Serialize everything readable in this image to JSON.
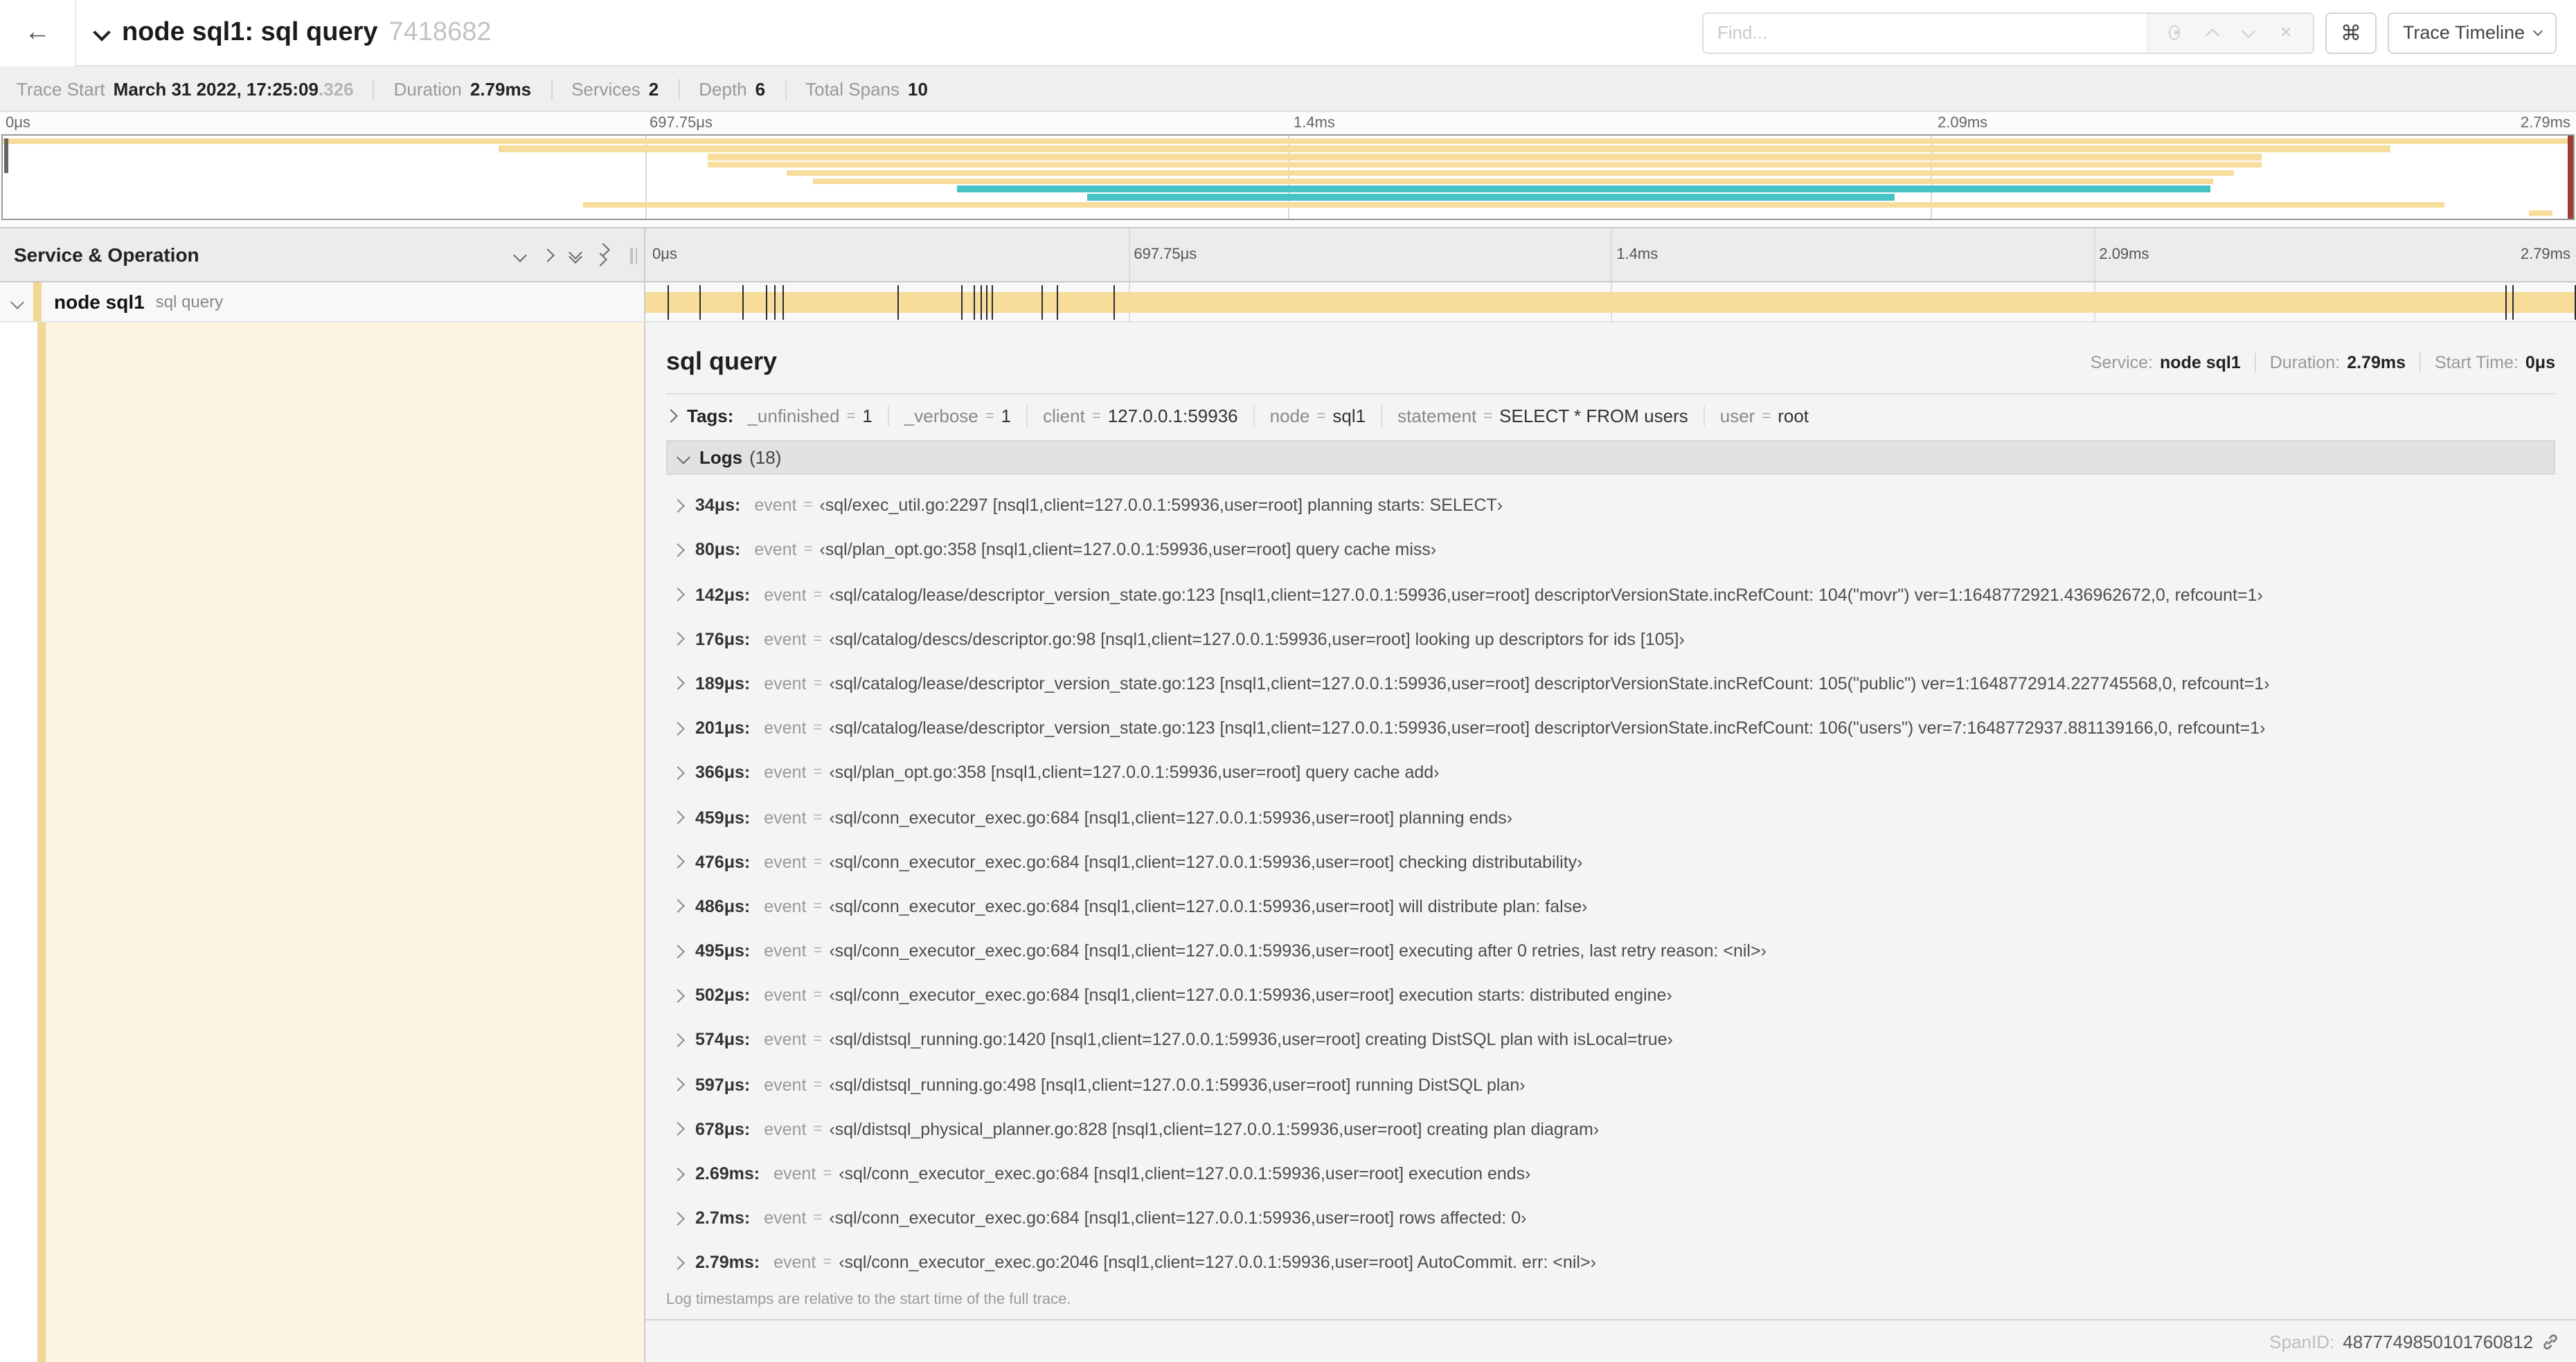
{
  "header": {
    "back_icon": "←",
    "title": "node sql1: sql query",
    "trace_id": "7418682",
    "find_placeholder": "Find...",
    "shortcut_key": "⌘",
    "view_selector": "Trace Timeline"
  },
  "trace_meta": {
    "items": [
      {
        "label": "Trace Start",
        "value": "March 31 2022, 17:25:09",
        "suffix": ".326"
      },
      {
        "label": "Duration",
        "value": "2.79ms",
        "suffix": ""
      },
      {
        "label": "Services",
        "value": "2",
        "suffix": ""
      },
      {
        "label": "Depth",
        "value": "6",
        "suffix": ""
      },
      {
        "label": "Total Spans",
        "value": "10",
        "suffix": ""
      }
    ]
  },
  "timeline": {
    "ticks": [
      "0μs",
      "697.75μs",
      "1.4ms",
      "2.09ms",
      "2.79ms"
    ],
    "total_us": 2790
  },
  "minimap": {
    "spans": [
      {
        "start": 0.0,
        "end": 1.0,
        "color": "#f7dd9b"
      },
      {
        "start": 0.193,
        "end": 0.929,
        "color": "#f7dd9b"
      },
      {
        "start": 0.274,
        "end": 0.879,
        "color": "#f7dd9b"
      },
      {
        "start": 0.274,
        "end": 0.879,
        "color": "#f7dd9b"
      },
      {
        "start": 0.305,
        "end": 0.868,
        "color": "#f7dd9b"
      },
      {
        "start": 0.315,
        "end": 0.86,
        "color": "#f7dd9b"
      },
      {
        "start": 0.371,
        "end": 0.859,
        "color": "#46c3c5"
      },
      {
        "start": 0.422,
        "end": 0.736,
        "color": "#46c3c5"
      },
      {
        "start": 0.226,
        "end": 0.95,
        "color": "#f7dd9b"
      },
      {
        "start": 0.983,
        "end": 0.992,
        "color": "#f7dd9b"
      }
    ]
  },
  "left_pane": {
    "header": "Service & Operation",
    "row": {
      "service": "node sql1",
      "operation": "sql query"
    }
  },
  "detail": {
    "title": "sql query",
    "meta": [
      {
        "label": "Service:",
        "value": "node sql1"
      },
      {
        "label": "Duration:",
        "value": "2.79ms"
      },
      {
        "label": "Start Time:",
        "value": "0μs"
      }
    ],
    "tags_label": "Tags:",
    "tags": [
      {
        "key": "_unfinished",
        "value": "1"
      },
      {
        "key": "_verbose",
        "value": "1"
      },
      {
        "key": "client",
        "value": "127.0.0.1:59936"
      },
      {
        "key": "node",
        "value": "sql1"
      },
      {
        "key": "statement",
        "value": "SELECT * FROM users"
      },
      {
        "key": "user",
        "value": "root"
      }
    ],
    "logs_label": "Logs",
    "logs_count": "(18)",
    "event_key": "event",
    "logs": [
      {
        "ts": "34μs:",
        "us": 34,
        "value": "‹sql/exec_util.go:2297 [nsql1,client=127.0.0.1:59936,user=root] planning starts: SELECT›"
      },
      {
        "ts": "80μs:",
        "us": 80,
        "value": "‹sql/plan_opt.go:358 [nsql1,client=127.0.0.1:59936,user=root] query cache miss›"
      },
      {
        "ts": "142μs:",
        "us": 142,
        "value": "‹sql/catalog/lease/descriptor_version_state.go:123 [nsql1,client=127.0.0.1:59936,user=root] descriptorVersionState.incRefCount: 104(\"movr\") ver=1:1648772921.436962672,0, refcount=1›"
      },
      {
        "ts": "176μs:",
        "us": 176,
        "value": "‹sql/catalog/descs/descriptor.go:98 [nsql1,client=127.0.0.1:59936,user=root] looking up descriptors for ids [105]›"
      },
      {
        "ts": "189μs:",
        "us": 189,
        "value": "‹sql/catalog/lease/descriptor_version_state.go:123 [nsql1,client=127.0.0.1:59936,user=root] descriptorVersionState.incRefCount: 105(\"public\") ver=1:1648772914.227745568,0, refcount=1›"
      },
      {
        "ts": "201μs:",
        "us": 201,
        "value": "‹sql/catalog/lease/descriptor_version_state.go:123 [nsql1,client=127.0.0.1:59936,user=root] descriptorVersionState.incRefCount: 106(\"users\") ver=7:1648772937.881139166,0, refcount=1›"
      },
      {
        "ts": "366μs:",
        "us": 366,
        "value": "‹sql/plan_opt.go:358 [nsql1,client=127.0.0.1:59936,user=root] query cache add›"
      },
      {
        "ts": "459μs:",
        "us": 459,
        "value": "‹sql/conn_executor_exec.go:684 [nsql1,client=127.0.0.1:59936,user=root] planning ends›"
      },
      {
        "ts": "476μs:",
        "us": 476,
        "value": "‹sql/conn_executor_exec.go:684 [nsql1,client=127.0.0.1:59936,user=root] checking distributability›"
      },
      {
        "ts": "486μs:",
        "us": 486,
        "value": "‹sql/conn_executor_exec.go:684 [nsql1,client=127.0.0.1:59936,user=root] will distribute plan: false›"
      },
      {
        "ts": "495μs:",
        "us": 495,
        "value": "‹sql/conn_executor_exec.go:684 [nsql1,client=127.0.0.1:59936,user=root] executing after 0 retries, last retry reason: <nil>›"
      },
      {
        "ts": "502μs:",
        "us": 502,
        "value": "‹sql/conn_executor_exec.go:684 [nsql1,client=127.0.0.1:59936,user=root] execution starts: distributed engine›"
      },
      {
        "ts": "574μs:",
        "us": 574,
        "value": "‹sql/distsql_running.go:1420 [nsql1,client=127.0.0.1:59936,user=root] creating DistSQL plan with isLocal=true›"
      },
      {
        "ts": "597μs:",
        "us": 597,
        "value": "‹sql/distsql_running.go:498 [nsql1,client=127.0.0.1:59936,user=root] running DistSQL plan›"
      },
      {
        "ts": "678μs:",
        "us": 678,
        "value": "‹sql/distsql_physical_planner.go:828 [nsql1,client=127.0.0.1:59936,user=root] creating plan diagram›"
      },
      {
        "ts": "2.69ms:",
        "us": 2690,
        "value": "‹sql/conn_executor_exec.go:684 [nsql1,client=127.0.0.1:59936,user=root] execution ends›"
      },
      {
        "ts": "2.7ms:",
        "us": 2700,
        "value": "‹sql/conn_executor_exec.go:684 [nsql1,client=127.0.0.1:59936,user=root] rows affected: 0›"
      },
      {
        "ts": "2.79ms:",
        "us": 2790,
        "value": "‹sql/conn_executor_exec.go:2046 [nsql1,client=127.0.0.1:59936,user=root] AutoCommit. err: <nil>›"
      }
    ],
    "footer_note": "Log timestamps are relative to the start time of the full trace.",
    "span_id_label": "SpanID:",
    "span_id": "4877749850101760812"
  },
  "colors": {
    "accent_beige": "#f7dd9b",
    "accent_teal": "#46c3c5",
    "selected_row_tint": "#fdf5e2"
  }
}
